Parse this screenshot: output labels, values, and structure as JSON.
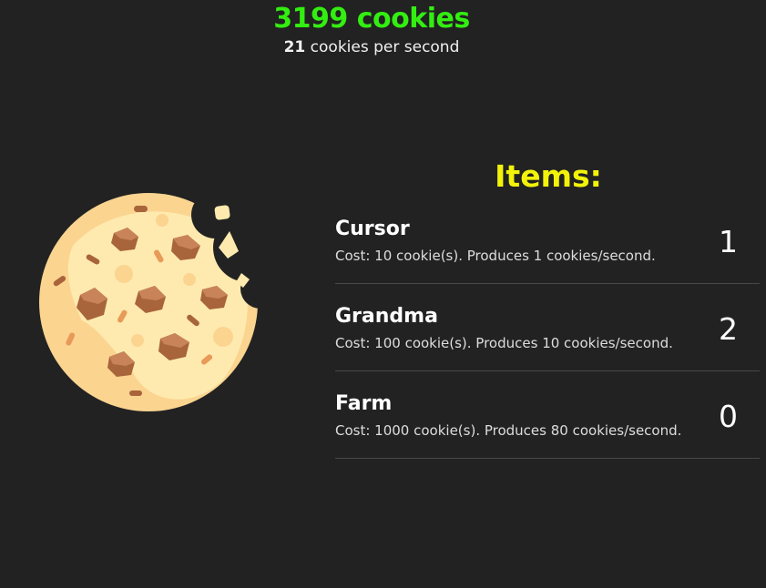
{
  "score": {
    "cookies": "3199 cookies",
    "per_second_value": "21",
    "per_second_suffix": " cookies per second"
  },
  "cookie": {
    "icon": "cookie-icon"
  },
  "items_title": "Items:",
  "items": [
    {
      "name": "Cursor",
      "description": "Cost: 10 cookie(s). Produces 1 cookies/second.",
      "count": "1"
    },
    {
      "name": "Grandma",
      "description": "Cost: 100 cookie(s). Produces 10 cookies/second.",
      "count": "2"
    },
    {
      "name": "Farm",
      "description": "Cost: 1000 cookie(s). Produces 80 cookies/second.",
      "count": "0"
    }
  ],
  "colors": {
    "background": "#222222",
    "score": "#33ee11",
    "items_title": "#f2f20a"
  }
}
